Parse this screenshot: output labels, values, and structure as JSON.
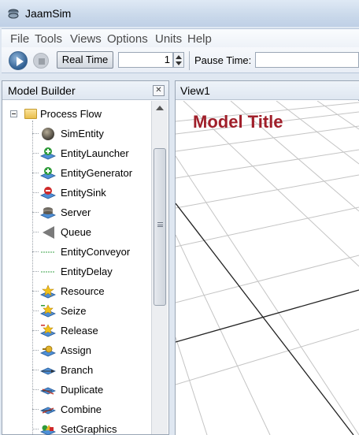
{
  "window": {
    "title": "JaamSim"
  },
  "menu": [
    "File",
    "Tools",
    "Views",
    "Options",
    "Units",
    "Help"
  ],
  "toolbar": {
    "realtime_label": "Real Time",
    "speed_value": "1",
    "pause_label": "Pause Time:",
    "pause_value": ""
  },
  "model_builder": {
    "title": "Model Builder",
    "root": "Process Flow",
    "items": [
      {
        "label": "SimEntity",
        "icon": "sphere-icon"
      },
      {
        "label": "EntityLauncher",
        "icon": "launcher-icon"
      },
      {
        "label": "EntityGenerator",
        "icon": "generator-icon"
      },
      {
        "label": "EntitySink",
        "icon": "sink-icon"
      },
      {
        "label": "Server",
        "icon": "server-icon"
      },
      {
        "label": "Queue",
        "icon": "queue-icon"
      },
      {
        "label": "EntityConveyor",
        "icon": "conveyor-icon"
      },
      {
        "label": "EntityDelay",
        "icon": "delay-icon"
      },
      {
        "label": "Resource",
        "icon": "resource-icon"
      },
      {
        "label": "Seize",
        "icon": "seize-icon"
      },
      {
        "label": "Release",
        "icon": "release-icon"
      },
      {
        "label": "Assign",
        "icon": "assign-icon"
      },
      {
        "label": "Branch",
        "icon": "branch-icon"
      },
      {
        "label": "Duplicate",
        "icon": "duplicate-icon"
      },
      {
        "label": "Combine",
        "icon": "combine-icon"
      },
      {
        "label": "SetGraphics",
        "icon": "setgraphics-icon"
      }
    ]
  },
  "view": {
    "title": "View1",
    "model_title": "Model Title"
  }
}
